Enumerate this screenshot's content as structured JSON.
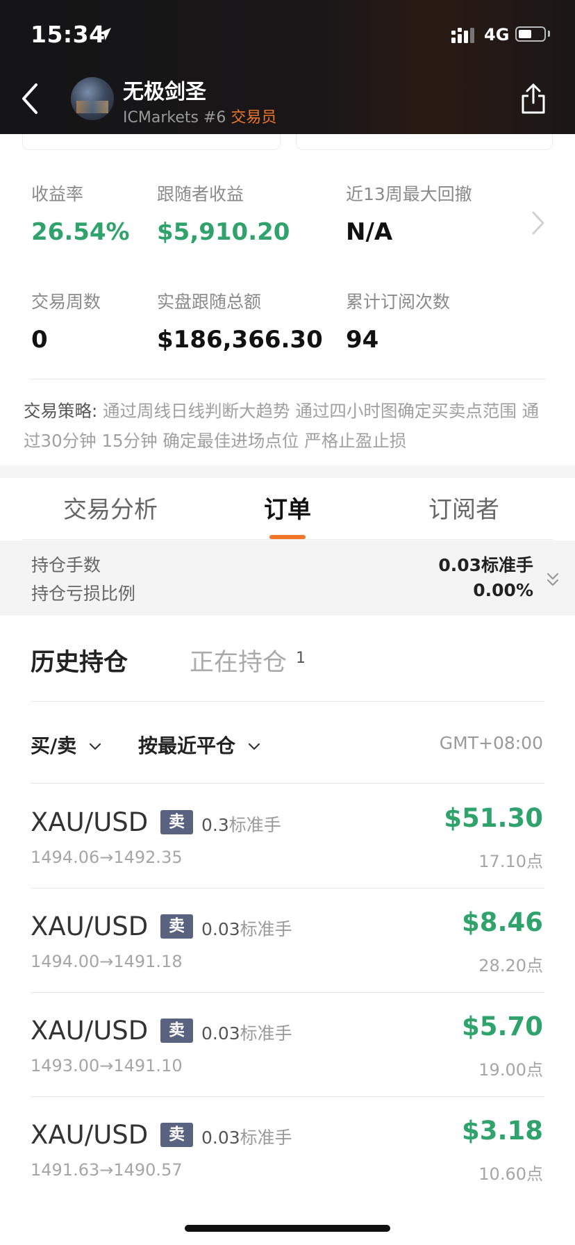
{
  "status_bar": {
    "time": "15:34",
    "network": "4G"
  },
  "header": {
    "trader_name": "无极剑圣",
    "broker": "ICMarkets #6",
    "role": "交易员"
  },
  "stats": {
    "return_label": "收益率",
    "return_value": "26.54%",
    "follower_profit_label": "跟随者收益",
    "follower_profit_value": "$5,910.20",
    "drawdown_label": "近13周最大回撤",
    "drawdown_value": "N/A",
    "weeks_label": "交易周数",
    "weeks_value": "0",
    "live_total_label": "实盘跟随总额",
    "live_total_value": "$186,366.30",
    "subs_label": "累计订阅次数",
    "subs_value": "94"
  },
  "strategy": {
    "label": "交易策略:",
    "text": " 通过周线日线判断大趋势 通过四小时图确定买卖点范围 通过30分钟 15分钟 确定最佳进场点位 严格止盈止损"
  },
  "tabs": [
    "交易分析",
    "订单",
    "订阅者"
  ],
  "summary": {
    "lots_label": "持仓手数",
    "lots_value": "0.03标准手",
    "loss_label": "持仓亏损比例",
    "loss_value": "0.00%"
  },
  "position_tabs": {
    "history": "历史持仓",
    "current": "正在持仓",
    "current_count": "1"
  },
  "filters": {
    "side": "买/卖",
    "sort": "按最近平仓",
    "timezone": "GMT+08:00"
  },
  "orders": [
    {
      "symbol": "XAU/USD",
      "side": "卖",
      "lots": "0.3",
      "unit": "标准手",
      "prices": "1494.06→1492.35",
      "profit": "$51.30",
      "points": "17.10点"
    },
    {
      "symbol": "XAU/USD",
      "side": "卖",
      "lots": "0.03",
      "unit": "标准手",
      "prices": "1494.00→1491.18",
      "profit": "$8.46",
      "points": "28.20点"
    },
    {
      "symbol": "XAU/USD",
      "side": "卖",
      "lots": "0.03",
      "unit": "标准手",
      "prices": "1493.00→1491.10",
      "profit": "$5.70",
      "points": "19.00点"
    },
    {
      "symbol": "XAU/USD",
      "side": "卖",
      "lots": "0.03",
      "unit": "标准手",
      "prices": "1491.63→1490.57",
      "profit": "$3.18",
      "points": "10.60点"
    }
  ],
  "colors": {
    "accent": "#f0762a",
    "profit_green": "#2fa36b",
    "badge": "#596380"
  }
}
